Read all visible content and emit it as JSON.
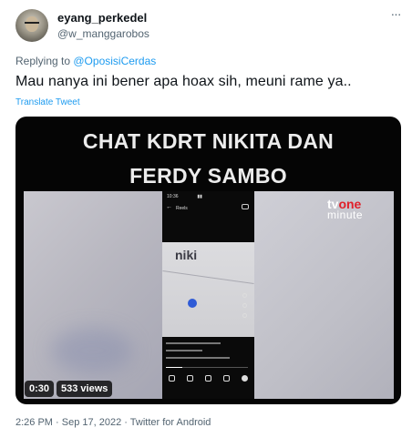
{
  "author": {
    "display_name": "eyang_perkedel",
    "handle": "@w_manggarobos"
  },
  "more_icon": "more-horizontal-icon",
  "reply": {
    "prefix": "Replying to ",
    "target": "@OposisiCerdas"
  },
  "tweet": {
    "text": "Mau nanya ini bener apa hoax sih, meuni rame ya..",
    "translate_label": "Translate Tweet"
  },
  "media": {
    "title_line1": "CHAT KDRT NIKITA DAN",
    "title_line2": "FERDY SAMBO",
    "watermark_tv": "tv",
    "watermark_one": "one",
    "watermark_minute": "minute",
    "phone_reels_label": "Reels",
    "phone_caption": "niki",
    "duration": "0:30",
    "views": "533 views",
    "progress": 0.2
  },
  "footer": {
    "timestamp": "2:26 PM · Sep 17, 2022 · Twitter for Android"
  },
  "colors": {
    "link": "#1d9bf0",
    "secondary_text": "#536471",
    "primary_text": "#0f1419"
  }
}
